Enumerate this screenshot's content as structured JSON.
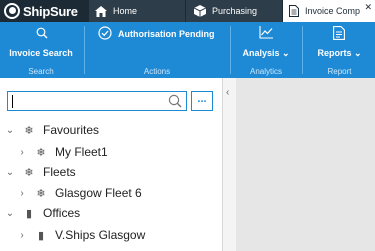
{
  "app": {
    "logo_text": "ShipSure"
  },
  "tabs": [
    {
      "label": "Home",
      "icon": "home-icon"
    },
    {
      "label": "Purchasing",
      "icon": "box-icon"
    },
    {
      "label": "Invoice Comp",
      "icon": "document-icon",
      "close": "✕"
    }
  ],
  "ribbon": {
    "invoice_search": {
      "label": "Invoice Search",
      "group": "Search",
      "icon": "search-icon"
    },
    "authorisation": {
      "label": "Authorisation Pending",
      "group": "Actions",
      "icon": "check-circle-icon"
    },
    "analysis": {
      "label": "Analysis",
      "group": "Analytics",
      "icon": "chart-line-icon"
    },
    "reports": {
      "label": "Reports",
      "group": "Report",
      "icon": "report-icon"
    }
  },
  "search": {
    "value": "",
    "more_label": "..."
  },
  "tree": [
    {
      "label": "Favourites",
      "level": 0,
      "expanded": true,
      "icon": "snowflake-icon"
    },
    {
      "label": "My Fleet1",
      "level": 1,
      "expanded": false,
      "icon": "snowflake-icon"
    },
    {
      "label": "Fleets",
      "level": 0,
      "expanded": true,
      "icon": "snowflake-icon"
    },
    {
      "label": "Glasgow Fleet 6",
      "level": 1,
      "expanded": false,
      "icon": "snowflake-icon"
    },
    {
      "label": "Offices",
      "level": 0,
      "expanded": true,
      "icon": "building-icon"
    },
    {
      "label": "V.Ships Glasgow",
      "level": 1,
      "expanded": false,
      "icon": "building-icon"
    }
  ],
  "colors": {
    "ribbon": "#1e8ad6",
    "titlebar": "#1c2a35",
    "content_bg": "#e6e6e6"
  }
}
